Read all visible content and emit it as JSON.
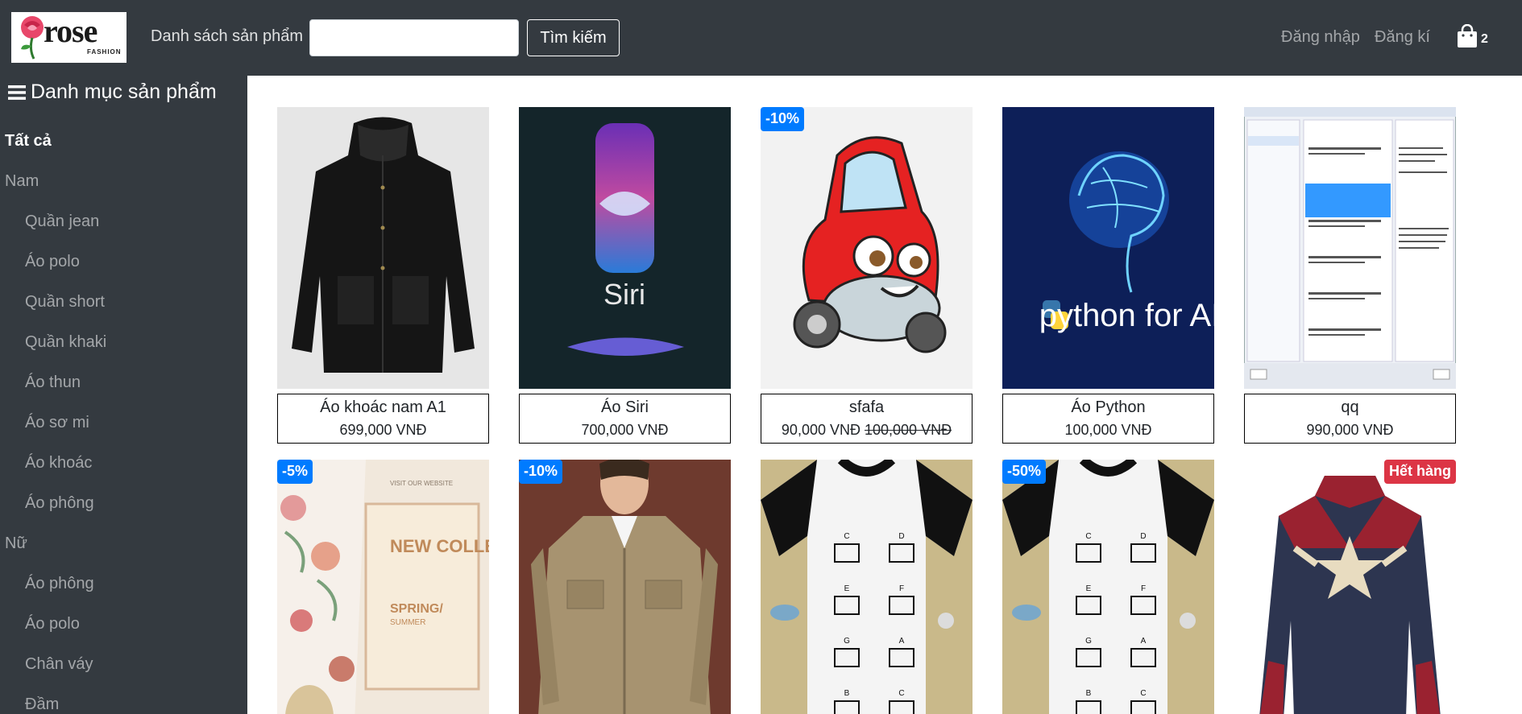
{
  "header": {
    "logo_text": "rose",
    "logo_sub": "FASHION",
    "nav_label": "Danh sách sản phẩm",
    "search_placeholder": "",
    "search_button": "Tìm kiếm",
    "login": "Đăng nhập",
    "register": "Đăng kí",
    "cart_count": "2"
  },
  "sidebar": {
    "title": "Danh mục sản phẩm",
    "items": [
      {
        "label": "Tất cả"
      },
      {
        "label": "Nam"
      },
      {
        "label": "Quần jean"
      },
      {
        "label": "Áo polo"
      },
      {
        "label": "Quần short"
      },
      {
        "label": "Quần khaki"
      },
      {
        "label": "Áo thun"
      },
      {
        "label": "Áo sơ mi"
      },
      {
        "label": "Áo khoác"
      },
      {
        "label": "Áo phông"
      },
      {
        "label": "Nữ"
      },
      {
        "label": "Áo phông"
      },
      {
        "label": "Áo polo"
      },
      {
        "label": "Chân váy"
      },
      {
        "label": "Đầm"
      }
    ]
  },
  "products": [
    {
      "name": "Áo khoác nam A1",
      "price": "699,000 VNĐ",
      "old_price": "",
      "badge": "",
      "image": "black-jacket"
    },
    {
      "name": "Áo Siri",
      "price": "700,000 VNĐ",
      "old_price": "",
      "badge": "",
      "image": "siri-logo"
    },
    {
      "name": "sfafa",
      "price": "90,000 VNĐ",
      "old_price": "100,000 VNĐ",
      "badge": "-10%",
      "image": "red-cartoon-car"
    },
    {
      "name": "Áo Python",
      "price": "100,000 VNĐ",
      "old_price": "",
      "badge": "",
      "image": "python-for-ai"
    },
    {
      "name": "qq",
      "price": "990,000 VNĐ",
      "old_price": "",
      "badge": "",
      "image": "nuget-screenshot"
    },
    {
      "name": "",
      "price": "",
      "old_price": "",
      "badge": "-5%",
      "image": "new-collection-floral"
    },
    {
      "name": "",
      "price": "",
      "old_price": "",
      "badge": "-10%",
      "image": "khaki-jacket-man"
    },
    {
      "name": "",
      "price": "",
      "old_price": "",
      "badge": "",
      "image": "guitar-chord-tshirt"
    },
    {
      "name": "",
      "price": "",
      "old_price": "",
      "badge": "-50%",
      "image": "guitar-chord-tshirt"
    },
    {
      "name": "",
      "price": "",
      "old_price": "",
      "badge_out": "Hết hàng",
      "image": "red-blue-leather-jacket"
    }
  ],
  "image_texts": {
    "siri": "Siri",
    "python": "python for AI",
    "collection_title": "NEW COLLECTION",
    "collection_sub": "SPRING/",
    "collection_sub2": "SUMMER",
    "collection_top": "VISIT OUR WEBSITE",
    "chords": [
      "C",
      "D",
      "E",
      "F",
      "G",
      "A",
      "B",
      "C"
    ]
  }
}
